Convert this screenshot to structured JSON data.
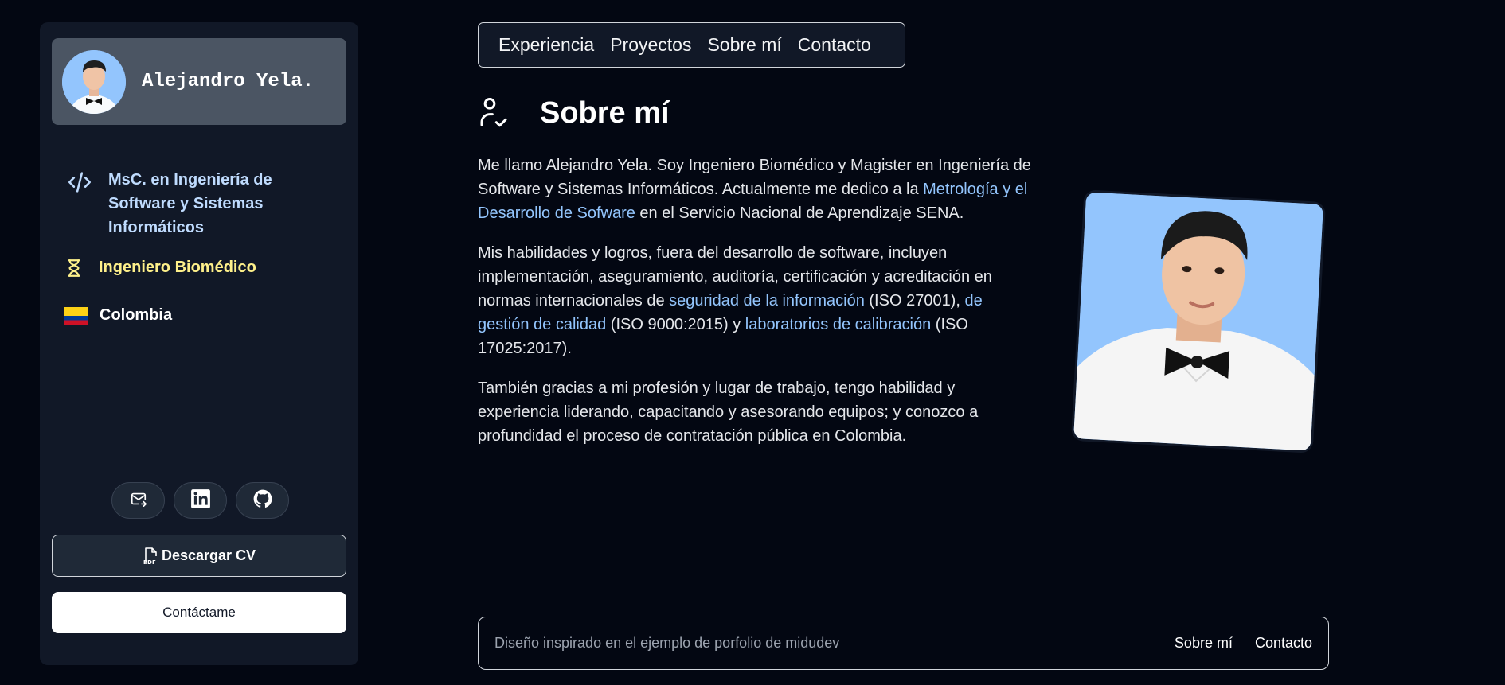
{
  "sidebar": {
    "profile": {
      "name": "Alejandro Yela."
    },
    "degree": "MsC. en Ingeniería de Software y Sistemas Informáticos",
    "profession": "Ingeniero Biomédico",
    "country": "Colombia",
    "social": [
      {
        "icon": "mail-icon"
      },
      {
        "icon": "linkedin-icon"
      },
      {
        "icon": "github-icon"
      }
    ],
    "cv_button": "Descargar CV",
    "contact_button": "Contáctame"
  },
  "nav": {
    "items": [
      "Experiencia",
      "Proyectos",
      "Sobre mí",
      "Contacto"
    ]
  },
  "about": {
    "title": "Sobre mí",
    "p1_a": "Me llamo Alejandro Yela. Soy Ingeniero Biomédico y Magister en Ingeniería de Software y Sistemas Informáticos. Actualmente me dedico a la ",
    "p1_link": "Metrología y el Desarrollo de Sofware",
    "p1_b": " en el Servicio Nacional de Aprendizaje SENA.",
    "p2_a": "Mis habilidades y logros, fuera del desarrollo de software, incluyen implementación, aseguramiento, auditoría, certificación y acreditación en normas internacionales de ",
    "p2_link1": "seguridad de la información",
    "p2_b": " (ISO 27001), ",
    "p2_link2": "de gestión de calidad",
    "p2_c": " (ISO 9000:2015) y ",
    "p2_link3": "laboratorios de calibración",
    "p2_d": " (ISO 17025:2017).",
    "p3": "También gracias a mi profesión y lugar de trabajo, tengo habilidad y experiencia liderando, capacitando y asesorando equipos; y conozco a profundidad el proceso de contratación pública en Colombia."
  },
  "footer": {
    "note": "Diseño inspirado en el ejemplo de porfolio de midudev",
    "links": [
      "Sobre mí",
      "Contacto"
    ]
  },
  "colors": {
    "background": "#030712",
    "panel": "#111827",
    "link": "#93c5fd",
    "accent_yellow": "#fef08a"
  }
}
